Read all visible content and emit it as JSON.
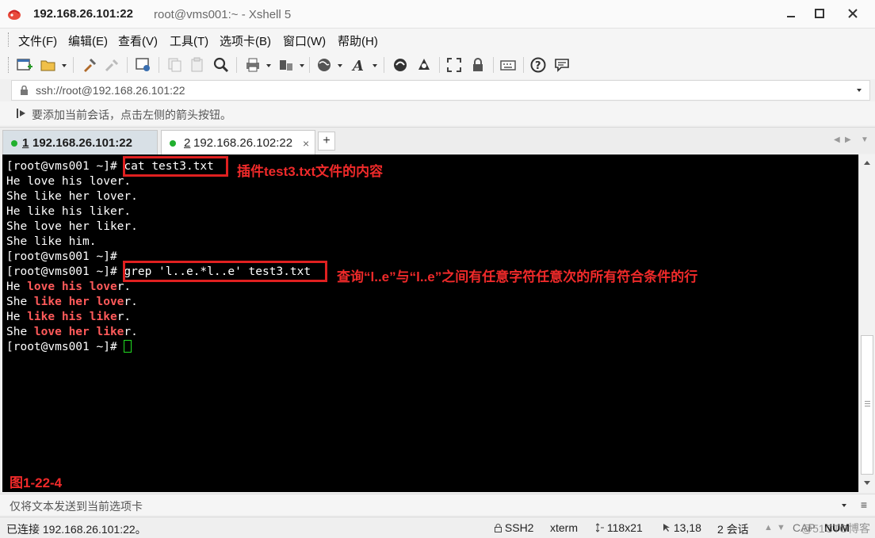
{
  "window": {
    "title_host": "192.168.26.101:22",
    "title_sub": "root@vms001:~ - Xshell 5"
  },
  "menu": [
    "文件(F)",
    "编辑(E)",
    "查看(V)",
    "工具(T)",
    "选项卡(B)",
    "窗口(W)",
    "帮助(H)"
  ],
  "toolbar": {
    "icons": [
      "new-session-icon",
      "open-folder-icon",
      "reconnect-icon",
      "disconnect-icon",
      "properties-icon",
      "copy-icon",
      "paste-icon",
      "find-icon",
      "print-icon",
      "transfer-icon",
      "globe-icon",
      "font-icon",
      "xftp-icon",
      "xagent-icon",
      "fullscreen-icon",
      "lock-icon",
      "keyboard-icon",
      "help-icon",
      "comment-icon"
    ]
  },
  "address": {
    "value": "ssh://root@192.168.26.101:22"
  },
  "hint": {
    "text": "要添加当前会话，点击左侧的箭头按钮。"
  },
  "tabs": [
    {
      "num": "1",
      "host": "192.168.26.101:22",
      "active": true
    },
    {
      "num": "2",
      "host": "192.168.26.102:22",
      "active": false,
      "close": "×"
    }
  ],
  "tab_add": "+",
  "tab_nav": {
    "prev": "◀",
    "next": "▶",
    "menu": "▼"
  },
  "terminal": {
    "lines": [
      {
        "prompt": "[root@vms001 ~]# ",
        "cmd": "cat test3.txt"
      },
      {
        "text": "He love his lover."
      },
      {
        "text": "She like her lover."
      },
      {
        "text": "He like his liker."
      },
      {
        "text": "She love her liker."
      },
      {
        "text": "She like him."
      },
      {
        "prompt": "[root@vms001 ~]# ",
        "cmd": ""
      },
      {
        "prompt": "[root@vms001 ~]# ",
        "cmd": "grep 'l..e.*l..e' test3.txt"
      },
      {
        "pre": "He ",
        "match": "love his love",
        "post": "r."
      },
      {
        "pre": "She ",
        "match": "like her love",
        "post": "r."
      },
      {
        "pre": "He ",
        "match": "like his like",
        "post": "r."
      },
      {
        "pre": "She ",
        "match": "love her like",
        "post": "r."
      },
      {
        "prompt": "[root@vms001 ~]# ",
        "cursor": true
      }
    ],
    "annotations": {
      "cat_note": "插件test3.txt文件的内容",
      "grep_note": "查询“l..e”与“l..e”之间有任意字符任意次的所有符合条件的行"
    },
    "figure_label": "图1-22-4",
    "highlight_color": "#ff5a5a",
    "annotation_color": "#ef2a2a"
  },
  "sendbar": {
    "placeholder": "仅将文本发送到当前选项卡",
    "menu_icon": "≡"
  },
  "status": {
    "connection": "已连接 192.168.26.101:22。",
    "protocol": "SSH2",
    "term": "xterm",
    "size": "118x21",
    "position": "13,18",
    "sessions": "2 会话",
    "caps": "CAP",
    "num": "NUM"
  },
  "watermark": "@51CTO博客"
}
